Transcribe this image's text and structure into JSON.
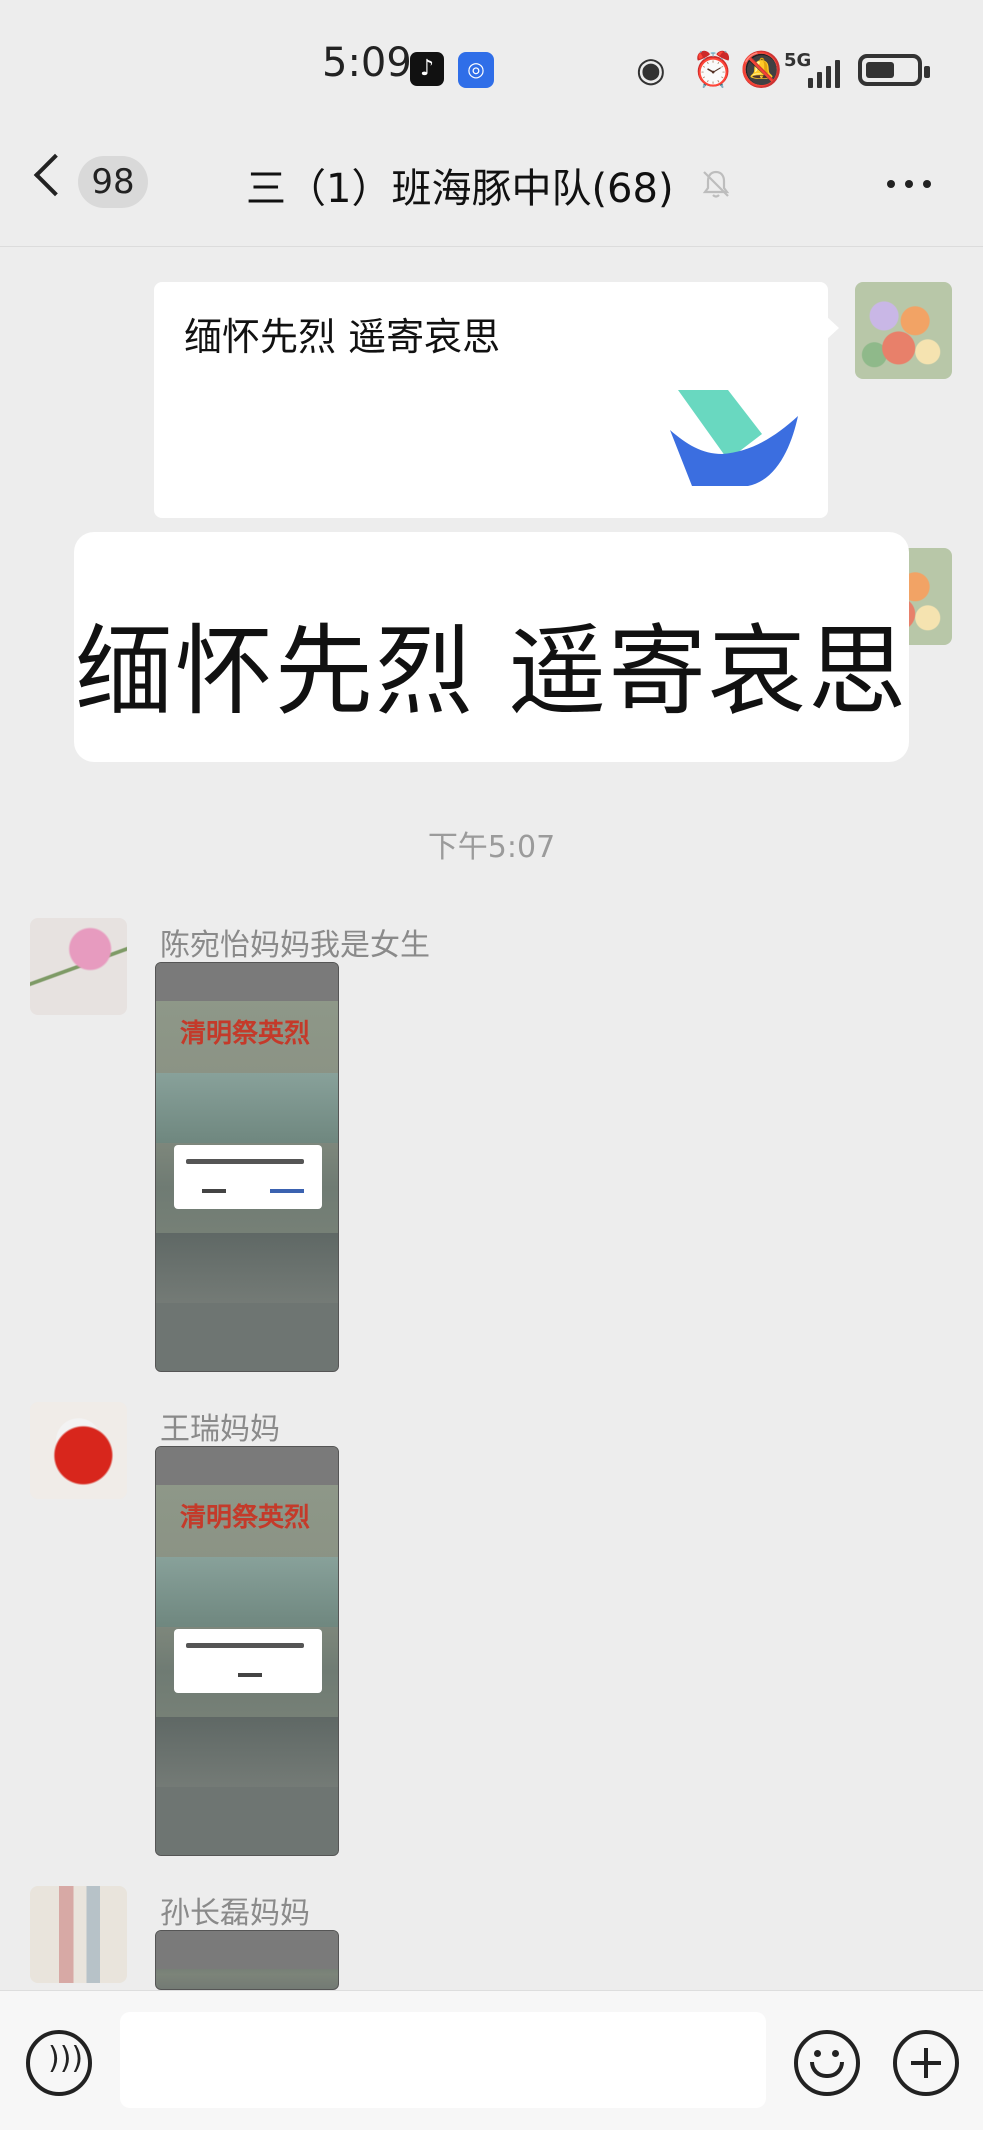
{
  "status_bar": {
    "time": "5:09",
    "network": "5G",
    "icons": [
      "tiktok-icon",
      "app-icon",
      "eye-icon",
      "alarm-icon",
      "mute-icon",
      "signal-icon",
      "battery-icon"
    ]
  },
  "header": {
    "unread_count": "98",
    "title": "三（1）班海豚中队(68)",
    "muted": true
  },
  "messages": {
    "card": {
      "title": "缅怀先烈 遥寄哀思"
    },
    "big_text": "缅怀先烈 遥寄哀思",
    "time_separator": "下午5:07",
    "senders": [
      "陈宛怡妈妈我是女生",
      "王瑞妈妈",
      "孙长磊妈妈"
    ],
    "thumb_poster": "清明祭英烈"
  },
  "colors": {
    "background": "#ededed",
    "bubble": "#ffffff",
    "logo_teal": "#4fd1b5",
    "logo_blue": "#3b6ee0"
  }
}
